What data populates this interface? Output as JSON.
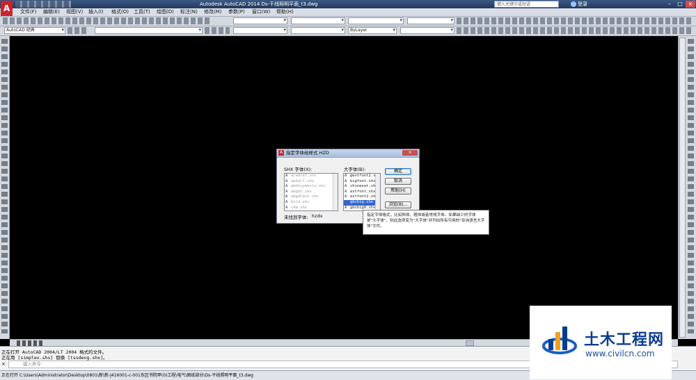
{
  "app": {
    "title": "Autodesk AutoCAD 2014    Ds-干线照明平面_t3.dwg",
    "search_placeholder": "键入关键字或短语",
    "signin": "登录",
    "logo_letter": "A"
  },
  "menu": [
    "文件(F)",
    "编辑(E)",
    "视图(V)",
    "插入(I)",
    "格式(O)",
    "工具(T)",
    "绘图(D)",
    "标注(N)",
    "修改(M)",
    "参数(P)",
    "窗口(W)",
    "帮助(H)"
  ],
  "toolbar": {
    "workspace": "AutoCAD 经典",
    "linetype": "ByLayer"
  },
  "dialog": {
    "title": "指定字体给样式 HZD",
    "shx_label": "SHX 字体(X):",
    "big_label": "大字体(B):",
    "shx_fonts": [
      "acadref.shx",
      "aehalf.shx",
      "amdtsymbols.shx",
      "amgdt.shx",
      "amgdtans.shx",
      "bold.shx",
      "cdm.shx"
    ],
    "big_fonts": [
      "@extfont2.shx",
      "bigfont.shx",
      "chineset.shx",
      "extfont.shx",
      "extfont2.shx",
      "gbcbig.shx",
      "gbcbig0.shx"
    ],
    "selected_big": "gbcbig.shx",
    "ok": "确定",
    "cancel": "取消",
    "help": "帮助(H)",
    "browse": "浏览(B)...",
    "missing_label": "未找到字体:",
    "missing_value": "hzdx"
  },
  "tooltip": "指定字体格式，比如斜体、粗体或者常规字体。如果缺少的字体是\"大字体\"，则此选项变为\"大字体\"并列出所有可用的\"亚洲语言大字体\"文件。",
  "command": {
    "line1": "正在打开 AutoCAD 2004/LT 2004 格式的文件。",
    "line2": "正在用 [simplex.shx] 替换 [tssdeng.shx]。",
    "placeholder": "键入命令"
  },
  "status": "正在打开  C:\\Users\\Administrator\\Desktop\\0801\\新\\新-J416001-c-001东区书院甲(0)工程\\电气\\图纸部分\\Ds-干线照明平面_t3.dwg",
  "watermark": {
    "title": "土木工程网",
    "url": "www.civilcn.com"
  }
}
